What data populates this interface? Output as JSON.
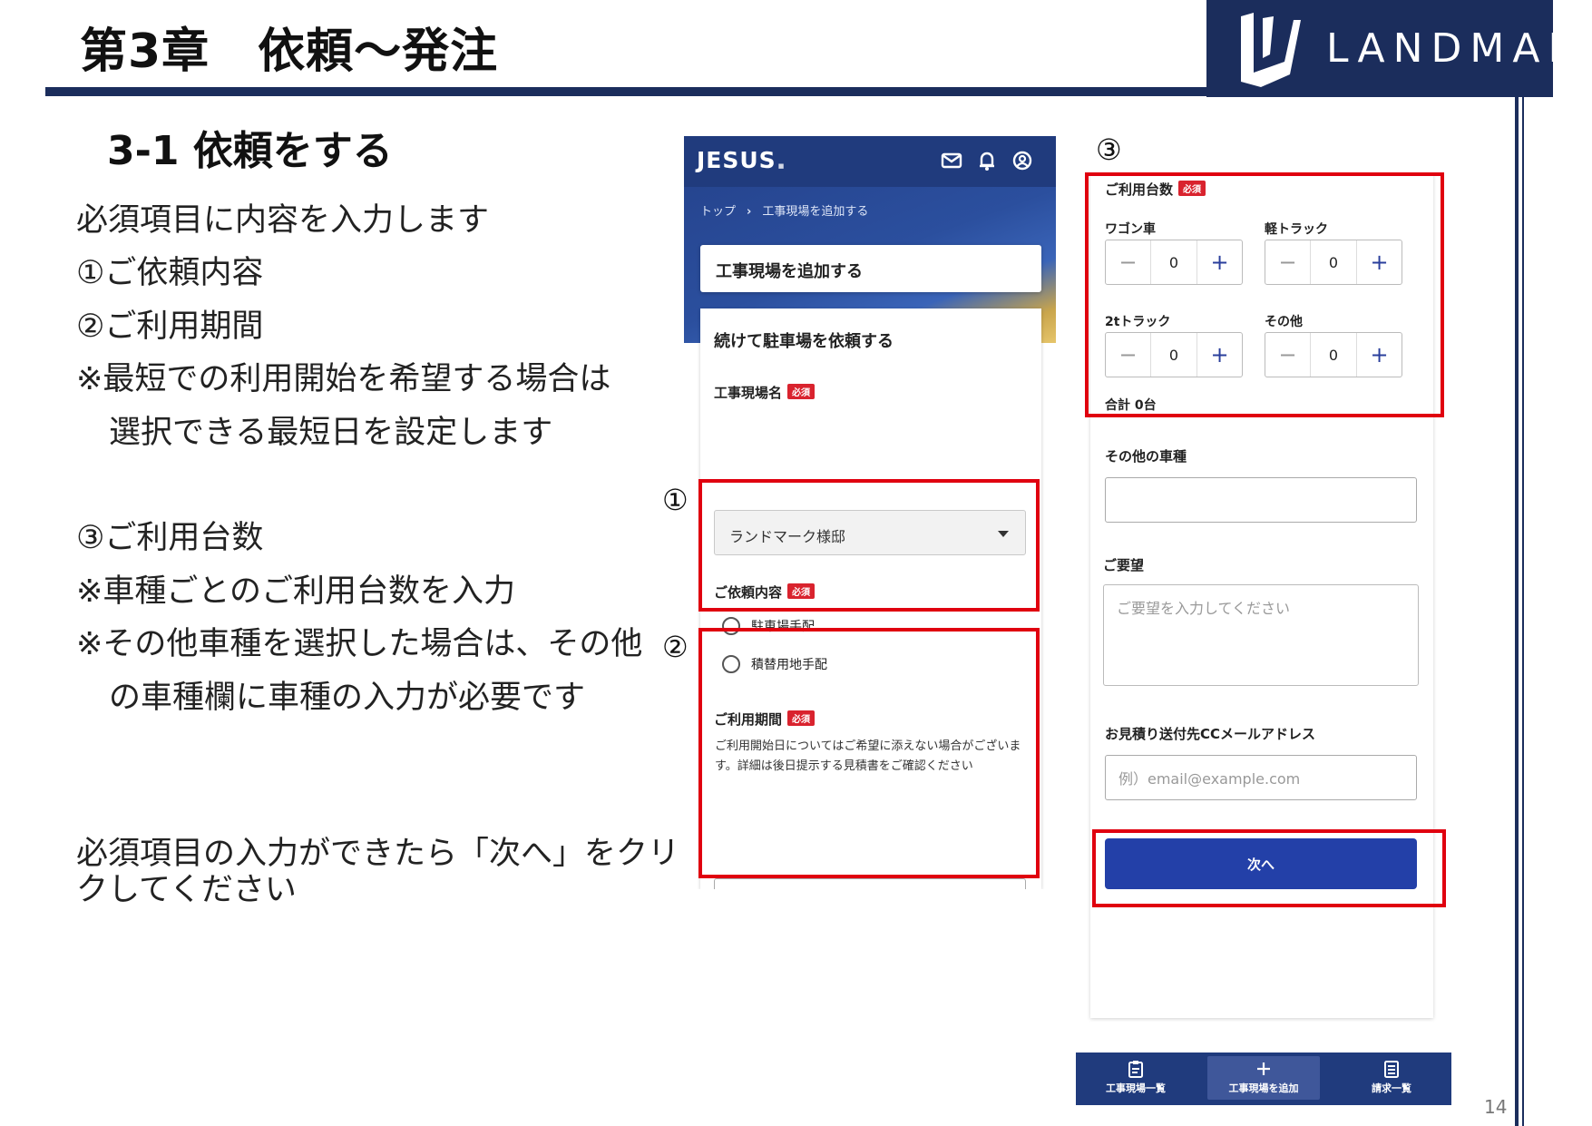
{
  "slide": {
    "chapter_title": "第3章　依頼～発注",
    "logo_text": "LANDMARK",
    "page_number": "14"
  },
  "section": {
    "title": "3-1 依頼をする",
    "lines": [
      "必須項目に内容を入力します",
      "①ご依頼内容",
      "②ご利用期間",
      "※最短での利用開始を希望する場合は",
      "選択できる最短日を設定します",
      "③ご利用台数",
      "※車種ごとのご利用台数を入力",
      "※その他車種を選択した場合は、その他",
      "の車種欄に車種の入力が必要です",
      "必須項目の入力ができたら「次へ」をクリッ",
      "クしてください"
    ]
  },
  "callouts": {
    "one": "①",
    "two": "②",
    "three": "③"
  },
  "phone1": {
    "brand": "JESUS",
    "breadcrumb": [
      "トップ",
      "工事現場を追加する"
    ],
    "page_title": "工事現場を追加する",
    "form_heading": "続けて駐車場を依頼する",
    "required_badge": "必須",
    "site_name_label": "工事現場名",
    "site_name_value": "ランドマーク様邸",
    "request_label": "ご依頼内容",
    "request_options": [
      "駐車場手配",
      "積替用地手配"
    ],
    "period_label": "ご利用期間",
    "period_note": "ご利用開始日についてはご希望に添えない場合がございます。詳細は後日提示する見積書をご確認ください",
    "range_separator": "~"
  },
  "phone2": {
    "count_label": "ご利用台数",
    "vehicles": [
      {
        "name": "ワゴン車",
        "count": "0"
      },
      {
        "name": "軽トラック",
        "count": "0"
      },
      {
        "name": "2tトラック",
        "count": "0"
      },
      {
        "name": "その他",
        "count": "0"
      }
    ],
    "total": "合計 0台",
    "other_type_label": "その他の車種",
    "request_label": "ご要望",
    "request_placeholder": "ご要望を入力してください",
    "cc_label": "お見積り送付先CCメールアドレス",
    "cc_placeholder": "例）email@example.com",
    "next_button": "次へ",
    "nav": [
      "工事現場一覧",
      "工事現場を追加",
      "請求一覧"
    ]
  },
  "colors": {
    "navy": "#1b2d5c",
    "app_blue": "#203b7d",
    "button_blue": "#2340a8",
    "highlight_red": "#e0000f",
    "badge_red": "#d9232e"
  }
}
